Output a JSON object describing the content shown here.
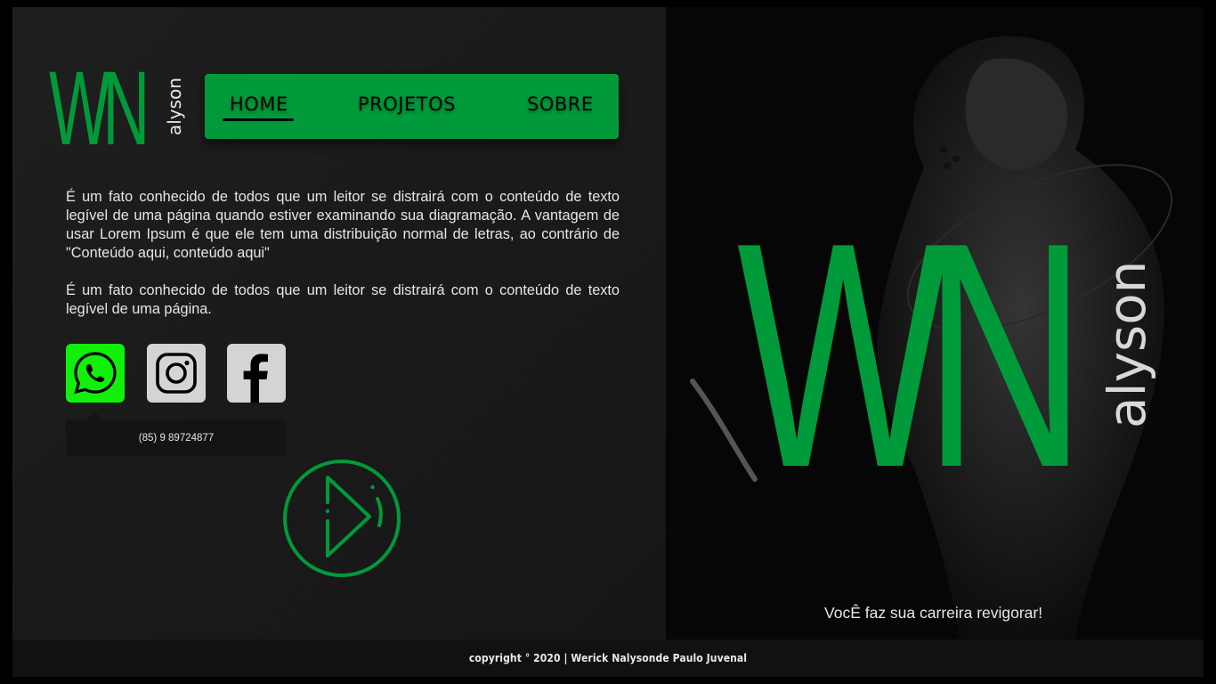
{
  "brand": {
    "letters": "WN",
    "suffix": "alyson",
    "accent_color": "#009a3a"
  },
  "nav": {
    "items": [
      {
        "label": "HOME",
        "active": true
      },
      {
        "label": "PROJETOS",
        "active": false
      },
      {
        "label": "SOBRE",
        "active": false
      }
    ]
  },
  "content": {
    "paragraph_1": "É um fato conhecido de todos que um leitor se distrairá com o conteúdo de texto legível de uma página quando estiver examinando sua diagramação. A vantagem de usar Lorem Ipsum é que ele tem uma distribuição normal de letras, ao contrário de \"Conteúdo aqui, conteúdo aqui\"",
    "paragraph_2": "É um fato conhecido de todos que um leitor se distrairá com o conteúdo de texto legível de uma página."
  },
  "social": {
    "items": [
      {
        "icon": "whatsapp-icon",
        "color": "#10f00a"
      },
      {
        "icon": "instagram-icon",
        "color": "#d4d4d4"
      },
      {
        "icon": "facebook-icon",
        "color": "#d4d4d4"
      }
    ],
    "phone": "(85) 9 89724877"
  },
  "hero": {
    "tagline": "VocÊ faz sua carreira revigorar!"
  },
  "footer": {
    "copyright": "copyright ° 2020 | Werick Nalysonde Paulo Juvenal"
  }
}
